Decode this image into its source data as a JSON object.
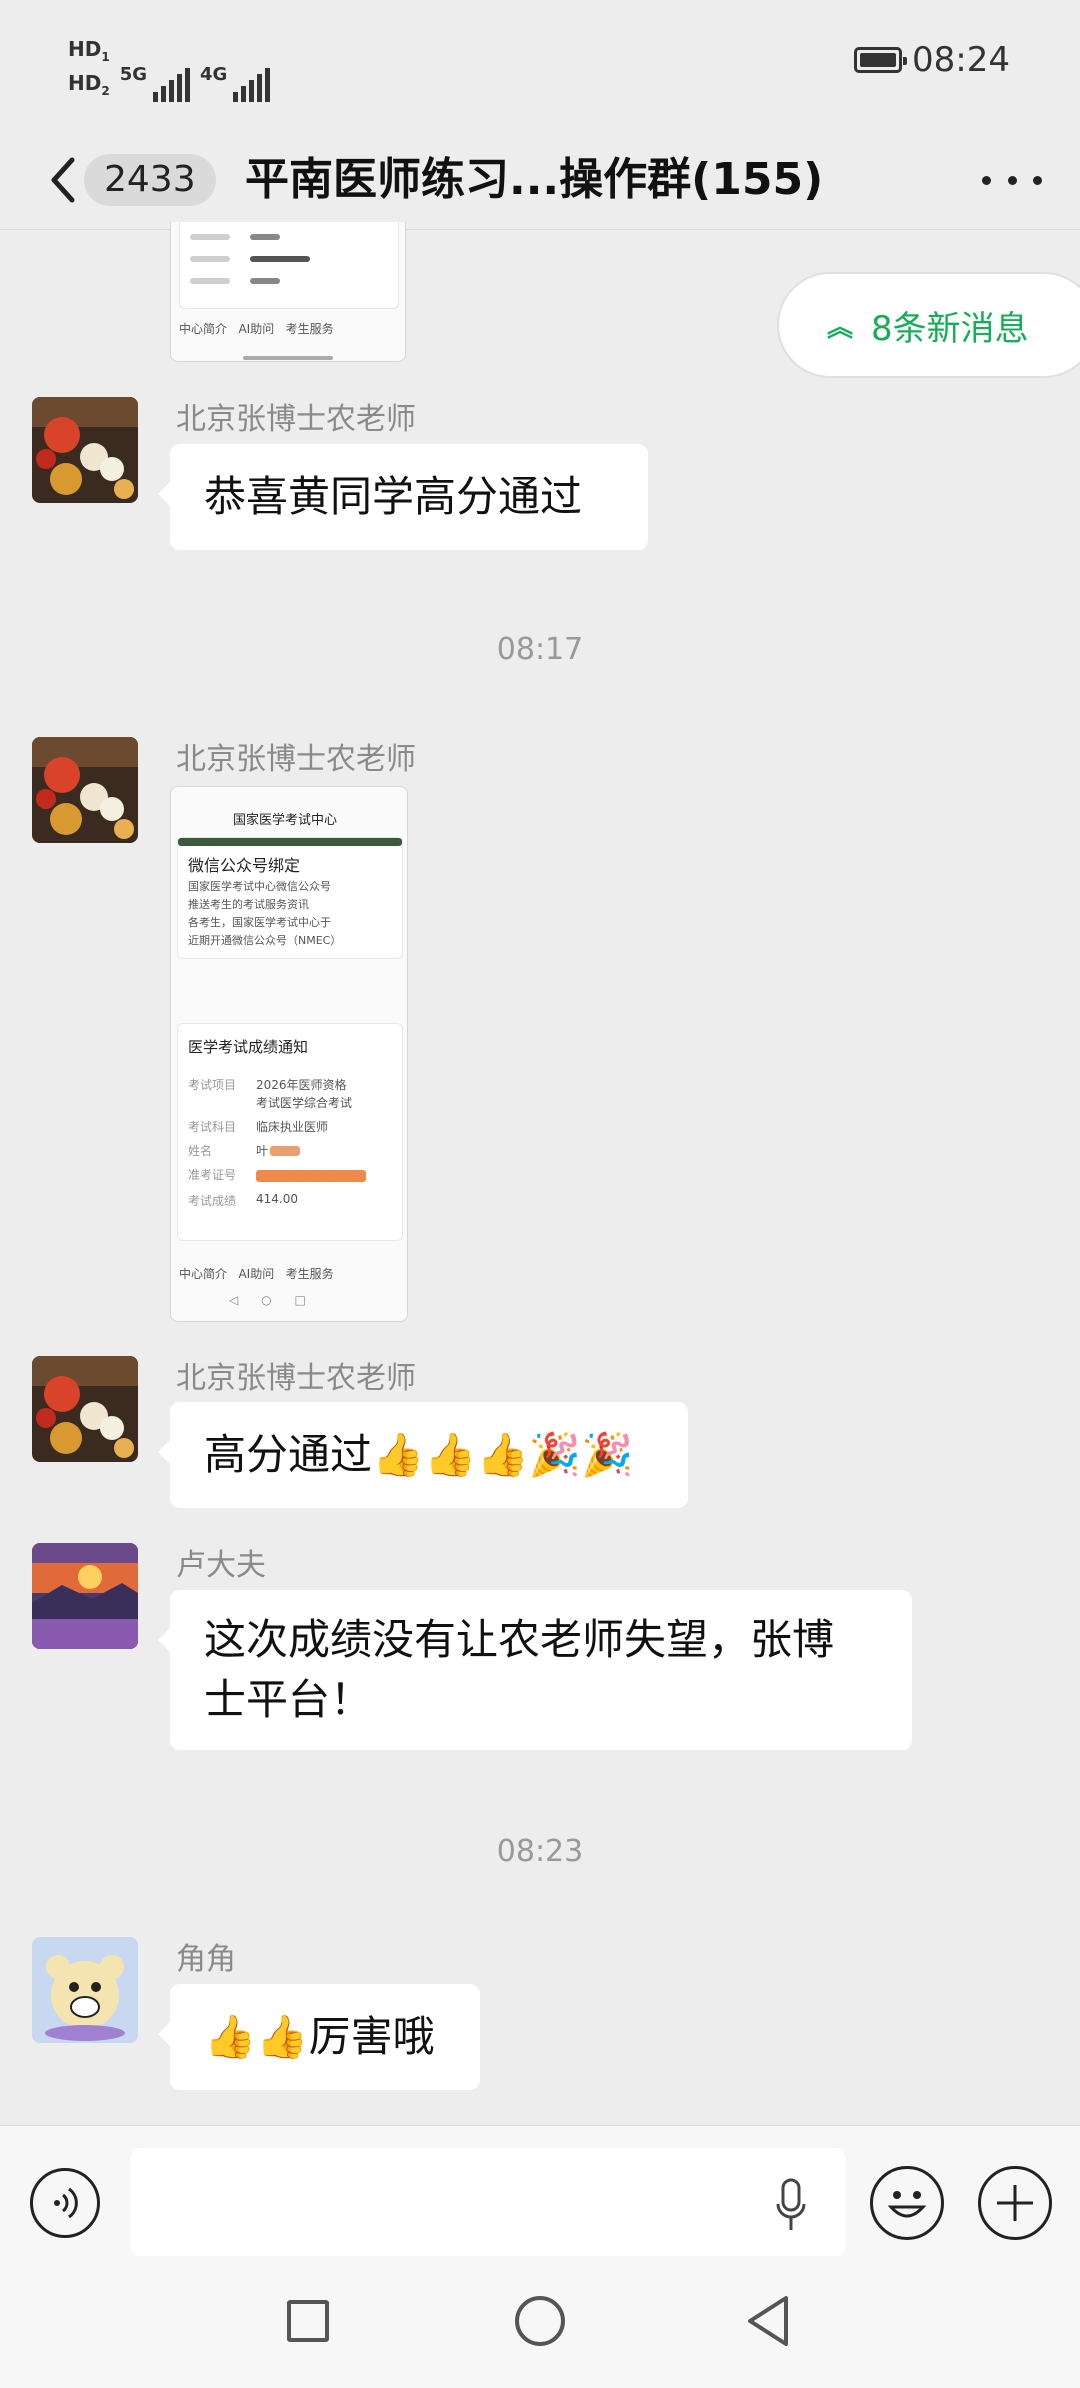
{
  "status_bar": {
    "hd1": "HD",
    "hd1_sub": "1",
    "hd2": "HD",
    "hd2_sub": "2",
    "net1": "5G",
    "net2": "4G",
    "time": "08:24"
  },
  "header": {
    "unread_count": "2433",
    "title": "平南医师练习...操作群(155)"
  },
  "new_messages_pill": {
    "label": "8条新消息"
  },
  "timestamps": [
    "08:17",
    "08:23"
  ],
  "messages": [
    {
      "sender": "北京张博士农老师",
      "text": "恭喜黄同学高分通过"
    },
    {
      "sender": "北京张博士农老师",
      "text": "[image]"
    },
    {
      "sender": "北京张博士农老师",
      "text": "高分通过",
      "emojis": "👍👍👍🎉🎉"
    },
    {
      "sender": "卢大夫",
      "line1": "这次成绩没有让农老师失望，张博",
      "line2": "士平台！"
    },
    {
      "sender": "角角",
      "emojis": "👍👍",
      "text": "厉害哦"
    }
  ],
  "image_thumb_top": {
    "tabs": [
      "中心简介",
      "AI助问",
      "考生服务"
    ]
  },
  "image_thumb_main": {
    "nav_title": "国家医学考试中心",
    "card1_title": "微信公众号绑定",
    "card1_body": [
      "国家医学考试中心微信公众号",
      "推送考生的考试服务资讯",
      "各考生，国家医学考试中心于",
      "近期开通微信公众号（NMEC）"
    ],
    "card2_title": "医学考试成绩通知",
    "fields": [
      {
        "label": "考试项目",
        "value": "2026年医师资格"
      },
      {
        "label": "",
        "value": "考试医学综合考试"
      },
      {
        "label": "考试科目",
        "value": "临床执业医师"
      },
      {
        "label": "姓名",
        "value": "叶"
      },
      {
        "label": "准考证号",
        "value": ""
      },
      {
        "label": "考试成绩",
        "value": "414.00"
      }
    ],
    "tabs": [
      "中心简介",
      "AI助问",
      "考生服务"
    ]
  },
  "colors": {
    "accent_green": "#1aad59",
    "background": "#ededed",
    "bubble": "#ffffff"
  }
}
